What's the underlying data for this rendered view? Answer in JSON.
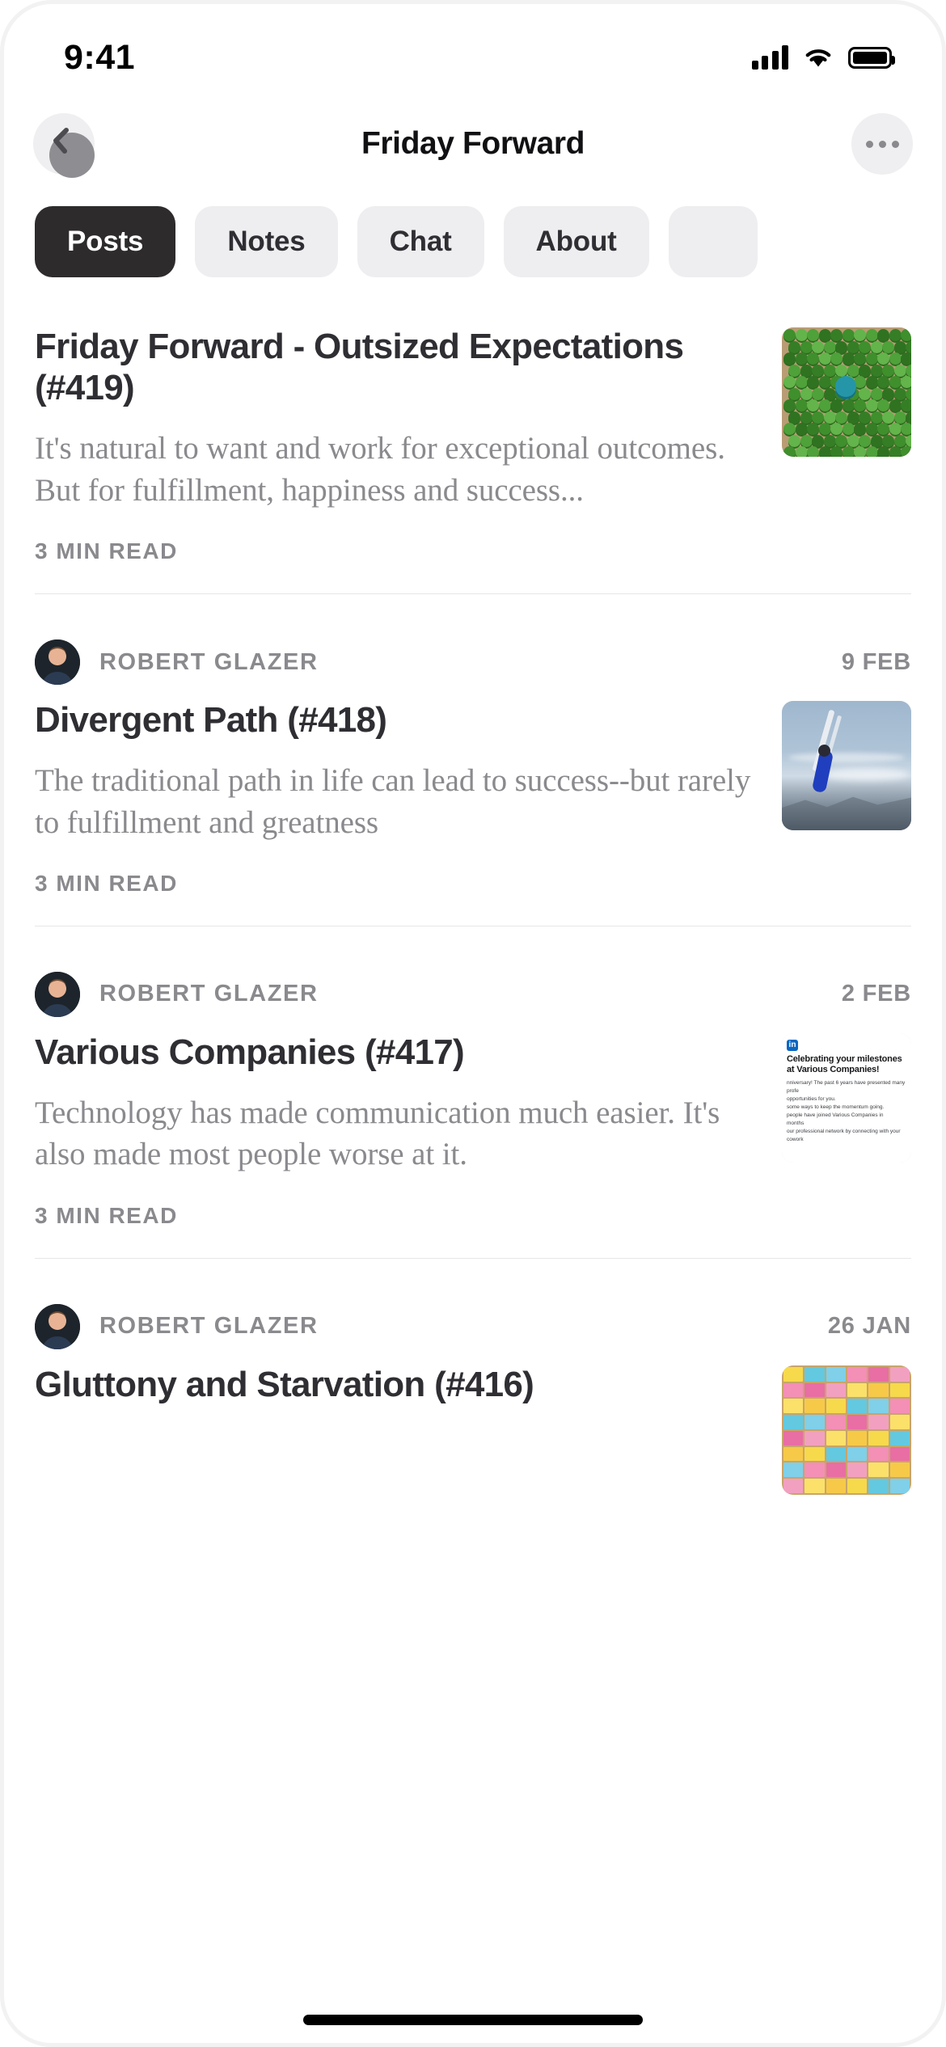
{
  "status_bar": {
    "time": "9:41",
    "cellular_icon": "cellular-signal-icon",
    "wifi_icon": "wifi-icon",
    "battery_icon": "battery-full-icon"
  },
  "header": {
    "title": "Friday Forward",
    "back_icon": "back-chevron-icon",
    "more_icon": "more-options-icon"
  },
  "tabs": [
    {
      "label": "Posts",
      "active": true
    },
    {
      "label": "Notes",
      "active": false
    },
    {
      "label": "Chat",
      "active": false
    },
    {
      "label": "About",
      "active": false
    },
    {
      "label": "",
      "active": false
    }
  ],
  "posts": [
    {
      "author": "",
      "date": "",
      "title": "Friday Forward - Outsized Expectations (#419)",
      "excerpt": "It's natural to want and work for exceptional outcomes. But for fulfillment, happiness and success...",
      "read_time": "3 MIN READ",
      "thumbnail": "green-pushpins-image"
    },
    {
      "author": "ROBERT GLAZER",
      "date": "9 FEB",
      "title": "Divergent Path (#418)",
      "excerpt": "The traditional path in life can lead to success--but rarely to fulfillment and greatness",
      "read_time": "3 MIN READ",
      "thumbnail": "skier-aerial-image"
    },
    {
      "author": "ROBERT GLAZER",
      "date": "2 FEB",
      "title": "Various Companies (#417)",
      "excerpt": "Technology has made communication much easier. It's also made most people worse at it.",
      "read_time": "3 MIN READ",
      "thumbnail": "linkedin-notification-image",
      "thumb_text": {
        "heading": "Celebrating your milestones at Various Companies!",
        "lines": [
          "nniversary! The past 6 years have presented many profe",
          " opportunities for you.",
          "some ways to keep the momentum going.",
          "people have joined Various Companies in",
          " months",
          "our professional network by connecting with your cowork"
        ]
      }
    },
    {
      "author": "ROBERT GLAZER",
      "date": "26 JAN",
      "title": "Gluttony and Starvation (#416)",
      "excerpt": "",
      "read_time": "",
      "thumbnail": "sticky-notes-image"
    }
  ],
  "colors": {
    "accent_dark": "#2e2b2c",
    "tab_inactive_bg": "#eeeef0",
    "muted_text": "#8a8a8e",
    "title_text": "#2e2e33"
  }
}
